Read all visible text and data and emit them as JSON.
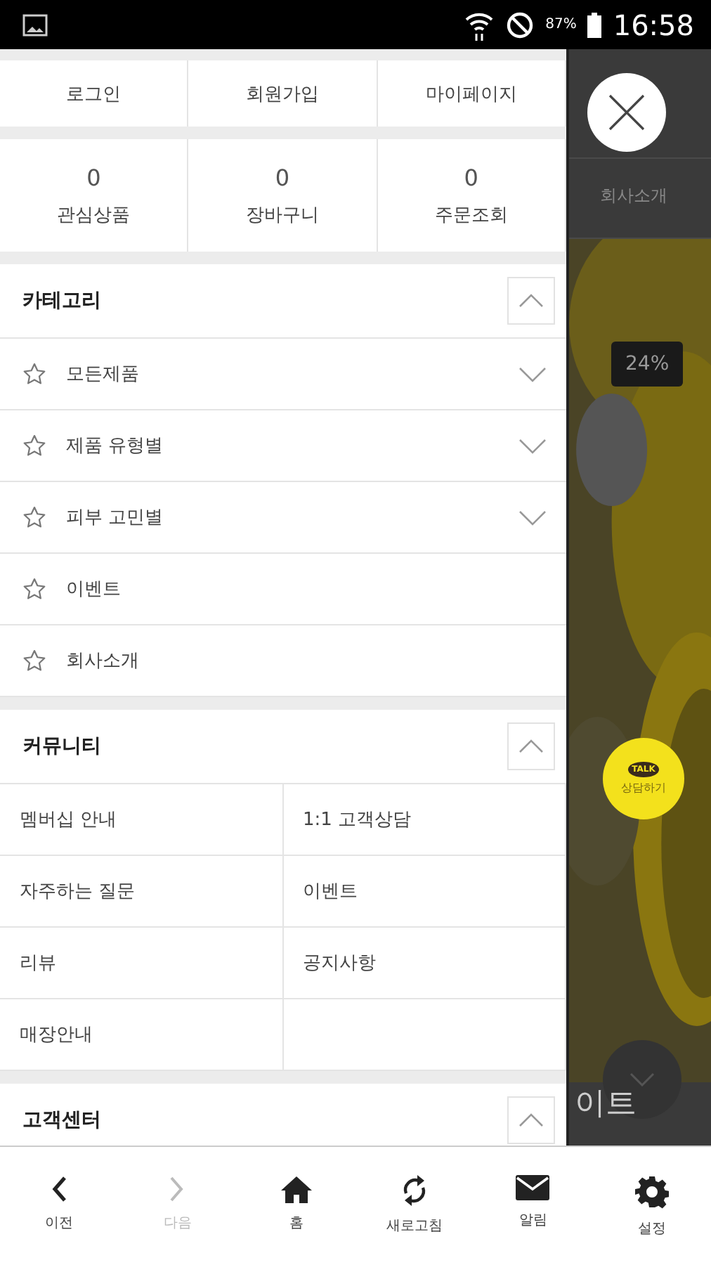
{
  "status_bar": {
    "battery": "87%",
    "time": "16:58"
  },
  "account_links": [
    "로그인",
    "회원가입",
    "마이페이지"
  ],
  "counters": [
    {
      "count": "0",
      "label": "관심상품"
    },
    {
      "count": "0",
      "label": "장바구니"
    },
    {
      "count": "0",
      "label": "주문조회"
    }
  ],
  "category": {
    "title": "카테고리",
    "expanded": true,
    "items": [
      {
        "label": "모든제품",
        "expandable": true
      },
      {
        "label": "제품 유형별",
        "expandable": true
      },
      {
        "label": "피부 고민별",
        "expandable": true
      },
      {
        "label": "이벤트",
        "expandable": false
      },
      {
        "label": "회사소개",
        "expandable": false
      }
    ]
  },
  "community": {
    "title": "커뮤니티",
    "expanded": true,
    "items": [
      "멤버십 안내",
      "1:1 고객상담",
      "자주하는 질문",
      "이벤트",
      "리뷰",
      "공지사항",
      "매장안내"
    ]
  },
  "customer_center": {
    "title": "고객센터",
    "expanded": true
  },
  "background_page": {
    "nav_label": "회사소개",
    "discount_badge": "24%",
    "chat_button": {
      "logo": "TALK",
      "label": "상담하기"
    },
    "partial_title": "이트"
  },
  "bottom_nav": [
    {
      "kind": "back",
      "label": "이전",
      "disabled": false
    },
    {
      "kind": "forward",
      "label": "다음",
      "disabled": true
    },
    {
      "kind": "home",
      "label": "홈",
      "disabled": false
    },
    {
      "kind": "refresh",
      "label": "새로고침",
      "disabled": false
    },
    {
      "kind": "mail",
      "label": "알림",
      "disabled": false
    },
    {
      "kind": "settings",
      "label": "설정",
      "disabled": false
    }
  ]
}
